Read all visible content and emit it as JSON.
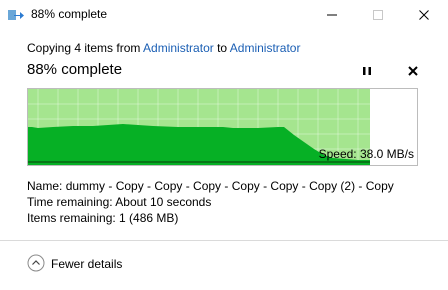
{
  "window": {
    "title": "88% complete"
  },
  "header": {
    "copy_prefix": "Copying 4 items from",
    "source": "Administrator",
    "to_word": "to",
    "destination": "Administrator",
    "status": "88% complete"
  },
  "progress": {
    "fraction": 0.88
  },
  "graph": {
    "speed_text": "Speed: 38.0 MB/s",
    "fill_color": "#a5e58f",
    "area_color": "#06b025",
    "line_color": "#0a3d0a"
  },
  "details": {
    "name_label": "Name:",
    "name_value": "dummy - Copy - Copy - Copy - Copy - Copy - Copy (2) - Copy",
    "time_label": "Time remaining:",
    "time_value": "About 10 seconds",
    "items_label": "Items remaining:",
    "items_value": "1 (486 MB)"
  },
  "footer": {
    "fewer_label": "Fewer details"
  },
  "icons": {
    "app": "copy-arrow-icon",
    "pause": "pause-icon",
    "stop": "close-icon",
    "minimize": "minimize-icon",
    "maximize": "maximize-icon",
    "close_window": "close-icon",
    "collapse": "chevron-up-icon"
  }
}
